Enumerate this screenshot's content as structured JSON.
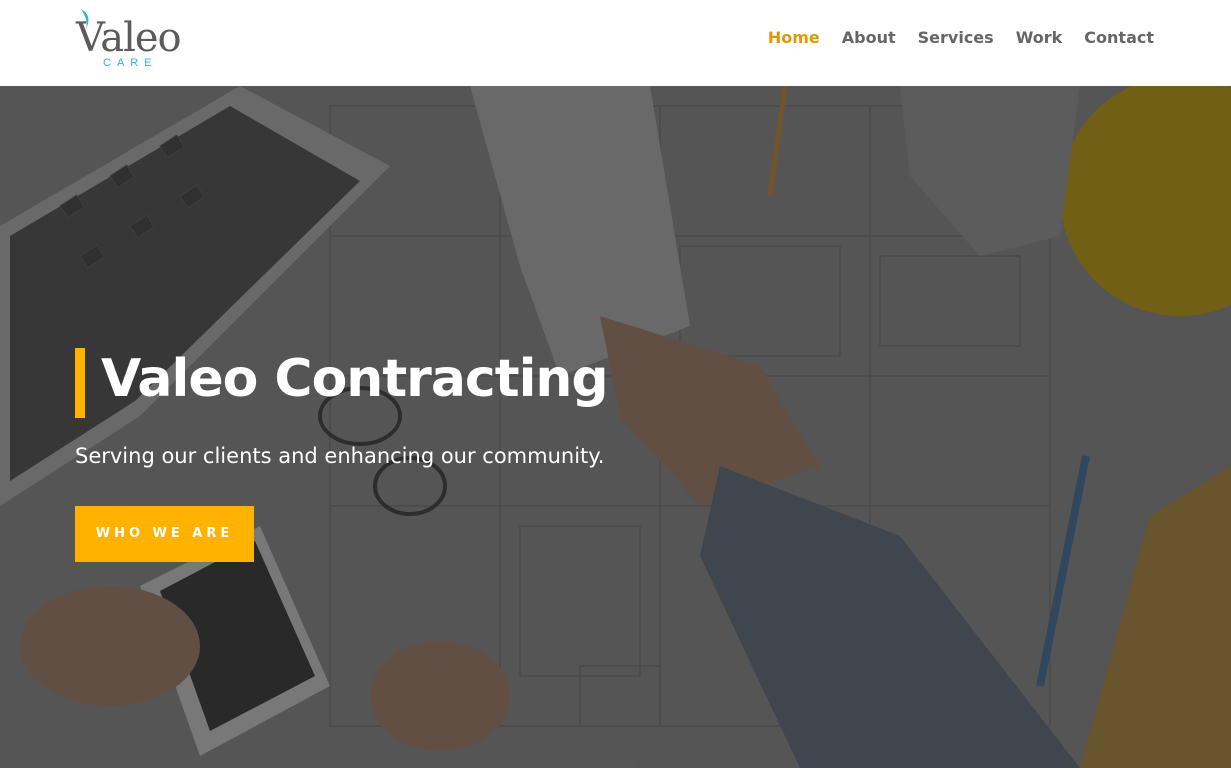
{
  "header": {
    "logo": {
      "word": "Valeo",
      "tagline": "CARE",
      "swoosh_color": "#2fb4d8"
    },
    "nav": [
      {
        "label": "Home",
        "active": true
      },
      {
        "label": "About",
        "active": false
      },
      {
        "label": "Services",
        "active": false
      },
      {
        "label": "Work",
        "active": false
      },
      {
        "label": "Contact",
        "active": false
      }
    ]
  },
  "hero": {
    "title": "Valeo Contracting",
    "subtitle": "Serving our clients and enhancing our community.",
    "button_label": "WHO WE ARE",
    "accent_color": "#ffb300"
  }
}
